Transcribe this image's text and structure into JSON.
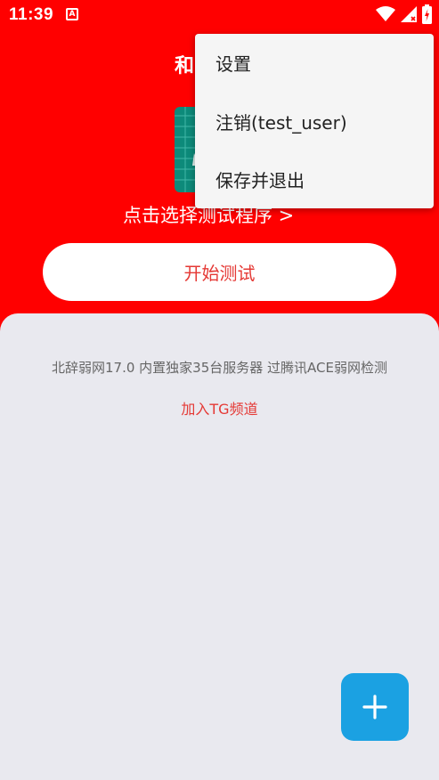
{
  "status_bar": {
    "time": "11:39",
    "notification_letter": "A"
  },
  "header": {
    "title": "和"
  },
  "main": {
    "select_program_label": "点击选择测试程序 >",
    "start_button_label": "开始测试"
  },
  "content": {
    "description": "北辞弱网17.0 内置独家35台服务器 过腾讯ACE弱网检测",
    "tg_link_label": "加入TG频道"
  },
  "menu": {
    "items": [
      {
        "label": "设置"
      },
      {
        "label": "注销(test_user)"
      },
      {
        "label": "保存并退出"
      }
    ]
  },
  "colors": {
    "primary_red": "#ff0000",
    "accent_text_red": "#e53935",
    "fab_blue": "#1ba1e2",
    "background": "#e9e9ef"
  }
}
